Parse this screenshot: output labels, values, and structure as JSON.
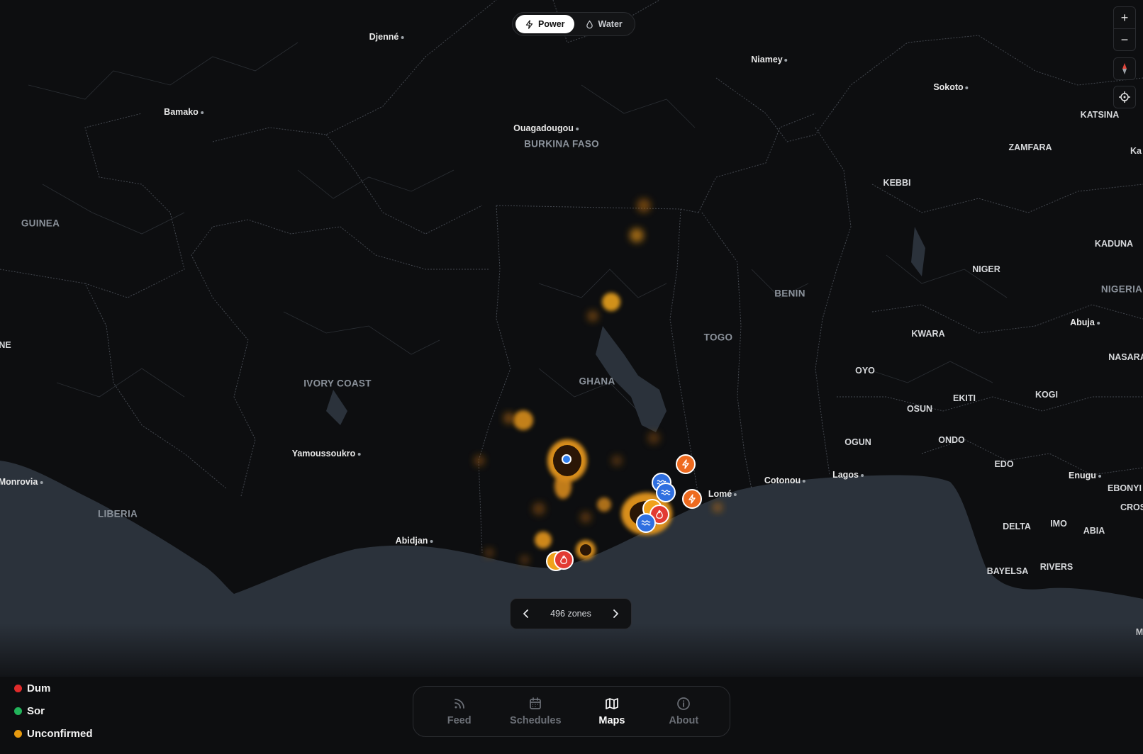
{
  "mode_toggle": {
    "options": [
      {
        "label": "Power",
        "icon": "lightning-icon",
        "active": true
      },
      {
        "label": "Water",
        "icon": "droplet-icon",
        "active": false
      }
    ]
  },
  "map_controls": {
    "zoom_in": "+",
    "zoom_out": "−"
  },
  "map": {
    "cities": [
      "Djenné",
      "Niamey",
      "Sokoto",
      "Bamako",
      "Ouagadougou",
      "Yamoussoukro",
      "Monrovia",
      "Abidjan",
      "Lomé",
      "Cotonou",
      "Lagos",
      "Abuja",
      "Enugu"
    ],
    "countries": [
      "BURKINA FASO",
      "GUINEA",
      "IVORY COAST",
      "GHANA",
      "TOGO",
      "BENIN",
      "LIBERIA",
      "NIGERIA"
    ],
    "states": [
      "KATSINA",
      "ZAMFARA",
      "KEBBI",
      "KADUNA",
      "NIGER",
      "KWARA",
      "OYO",
      "OSUN",
      "EKITI",
      "OGUN",
      "ONDO",
      "EDO",
      "KOGI",
      "NASARA",
      "DELTA",
      "IMO",
      "ABIA",
      "BAYELSA",
      "RIVERS",
      "EBONYI",
      "CROS",
      "Ka",
      "NE",
      "M"
    ]
  },
  "markers": [
    {
      "type": "power",
      "color": "#ee6a1f"
    },
    {
      "type": "power",
      "color": "#ee6a1f"
    },
    {
      "type": "water",
      "color": "#2f6fe0"
    },
    {
      "type": "water",
      "color": "#2f6fe0"
    },
    {
      "type": "water",
      "color": "#2f6fe0"
    },
    {
      "type": "fire",
      "color": "#e23b33"
    },
    {
      "type": "fire",
      "color": "#e23b33"
    },
    {
      "type": "unconfirmed",
      "color": "#f0a21b"
    },
    {
      "type": "unconfirmed",
      "color": "#f0a21b"
    }
  ],
  "pager": {
    "count_label": "496 zones"
  },
  "legend": [
    {
      "label": "Dum",
      "color": "#e02b2b"
    },
    {
      "label": "Sor",
      "color": "#22b35a"
    },
    {
      "label": "Unconfirmed",
      "color": "#e5990f"
    }
  ],
  "nav": [
    {
      "label": "Feed",
      "icon": "rss-icon",
      "active": false
    },
    {
      "label": "Schedules",
      "icon": "calendar-icon",
      "active": false
    },
    {
      "label": "Maps",
      "icon": "map-icon",
      "active": true
    },
    {
      "label": "About",
      "icon": "info-icon",
      "active": false
    }
  ]
}
